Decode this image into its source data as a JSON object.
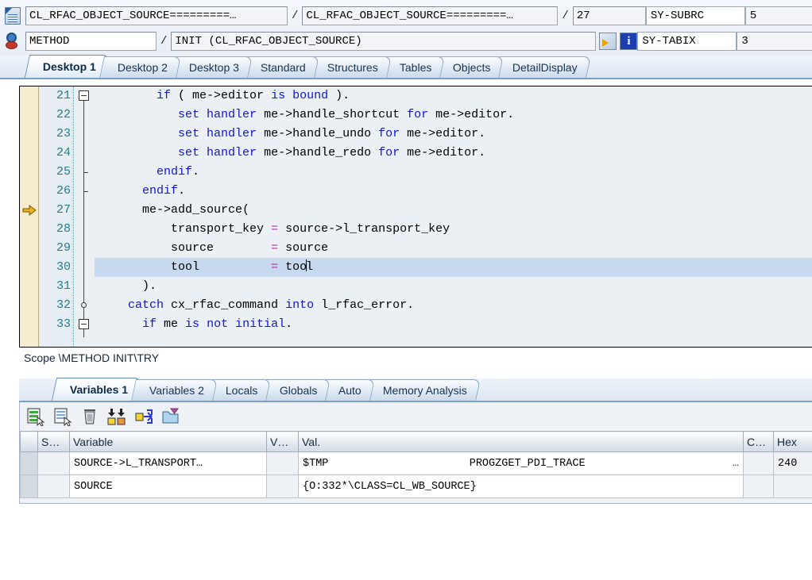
{
  "header": {
    "program_icon": "program-icon",
    "program_name": "CL_RFAC_OBJECT_SOURCE=========…",
    "include_name": "CL_RFAC_OBJECT_SOURCE=========…",
    "line_number": "27",
    "separator": "/",
    "event_type": "METHOD",
    "event_name": "INIT (CL_RFAC_OBJECT_SOURCE)",
    "jump_icon": "jump-to-icon",
    "info_icon": "info-icon",
    "sy_subrc_label": "SY-SUBRC",
    "sy_subrc_value": "5",
    "sy_tabix_label": "SY-TABIX",
    "sy_tabix_value": "3"
  },
  "desktop_tabs": [
    {
      "label": "Desktop 1",
      "active": true
    },
    {
      "label": "Desktop 2",
      "active": false
    },
    {
      "label": "Desktop 3",
      "active": false
    },
    {
      "label": "Standard",
      "active": false
    },
    {
      "label": "Structures",
      "active": false
    },
    {
      "label": "Tables",
      "active": false
    },
    {
      "label": "Objects",
      "active": false
    },
    {
      "label": "DetailDisplay",
      "active": false
    }
  ],
  "code": {
    "current_line": 27,
    "cursor_line": 30,
    "lines": [
      {
        "num": "21",
        "fold": "box",
        "html": "        <span class=\"kw\">if</span> ( me-&gt;editor <span class=\"kw\">is</span> <span class=\"kw\">bound</span> )."
      },
      {
        "num": "22",
        "fold": "",
        "html": "           <span class=\"kw\">set handler</span> me-&gt;handle_shortcut <span class=\"kw\">for</span> me-&gt;editor."
      },
      {
        "num": "23",
        "fold": "",
        "html": "           <span class=\"kw\">set handler</span> me-&gt;handle_undo <span class=\"kw\">for</span> me-&gt;editor."
      },
      {
        "num": "24",
        "fold": "",
        "html": "           <span class=\"kw\">set handler</span> me-&gt;handle_redo <span class=\"kw\">for</span> me-&gt;editor."
      },
      {
        "num": "25",
        "fold": "tick",
        "html": "        <span class=\"kw\">endif</span>."
      },
      {
        "num": "26",
        "fold": "tick",
        "html": "      <span class=\"kw\">endif</span>."
      },
      {
        "num": "27",
        "fold": "",
        "html": "      me-&gt;add_source("
      },
      {
        "num": "28",
        "fold": "",
        "html": "          transport_key <span class=\"op\">=</span> source-&gt;l_transport_key"
      },
      {
        "num": "29",
        "fold": "",
        "html": "          source        <span class=\"op\">=</span> source"
      },
      {
        "num": "30",
        "fold": "",
        "html": "          tool          <span class=\"op\">=</span> too<span class=\"caret\"></span>l"
      },
      {
        "num": "31",
        "fold": "",
        "html": "      )."
      },
      {
        "num": "32",
        "fold": "circ",
        "html": "    <span class=\"kw\">catch</span> cx_rfac_command <span class=\"kw\">into</span> l_rfac_error."
      },
      {
        "num": "33",
        "fold": "box",
        "html": "      <span class=\"kw\">if</span> me <span class=\"kw\">is</span> <span class=\"kw\">not</span> <span class=\"kw\">initial</span>."
      }
    ]
  },
  "scope": "Scope \\METHOD INIT\\TRY",
  "variable_tabs": [
    {
      "label": "Variables 1",
      "active": true
    },
    {
      "label": "Variables 2",
      "active": false
    },
    {
      "label": "Locals",
      "active": false
    },
    {
      "label": "Globals",
      "active": false
    },
    {
      "label": "Auto",
      "active": false
    },
    {
      "label": "Memory Analysis",
      "active": false
    }
  ],
  "variable_toolbar": [
    "display-list-green-icon",
    "display-list-blue-icon",
    "delete-icon",
    "load-variables-icon",
    "expand-icon",
    "new-folder-icon"
  ],
  "variables_grid": {
    "columns": [
      "",
      "S…",
      "Variable",
      "V…",
      "Val.",
      "C…",
      "Hex"
    ],
    "rows": [
      {
        "selector": "",
        "s": "",
        "variable": "SOURCE->L_TRANSPORT…",
        "v": "",
        "val_a": "$TMP",
        "val_b": "PROGZGET_PDI_TRACE",
        "val_c": "…",
        "c": "",
        "hex": "240"
      },
      {
        "selector": "",
        "s": "",
        "variable": "SOURCE",
        "v": "",
        "val_a": "{O:332*\\CLASS=CL_WB_SOURCE}",
        "val_b": "",
        "val_c": "",
        "c": "",
        "hex": ""
      }
    ]
  },
  "colors": {
    "keyword": "#1414d2",
    "operator": "#b0309b",
    "line_number": "#1f7f8c",
    "gutter_margin": "#f7ecd0",
    "code_bg": "#eaf0f4",
    "cursor_line_highlight": "#c6d9ef",
    "current_arrow": "#e8b21b",
    "tab_border": "#7b9fc9"
  }
}
